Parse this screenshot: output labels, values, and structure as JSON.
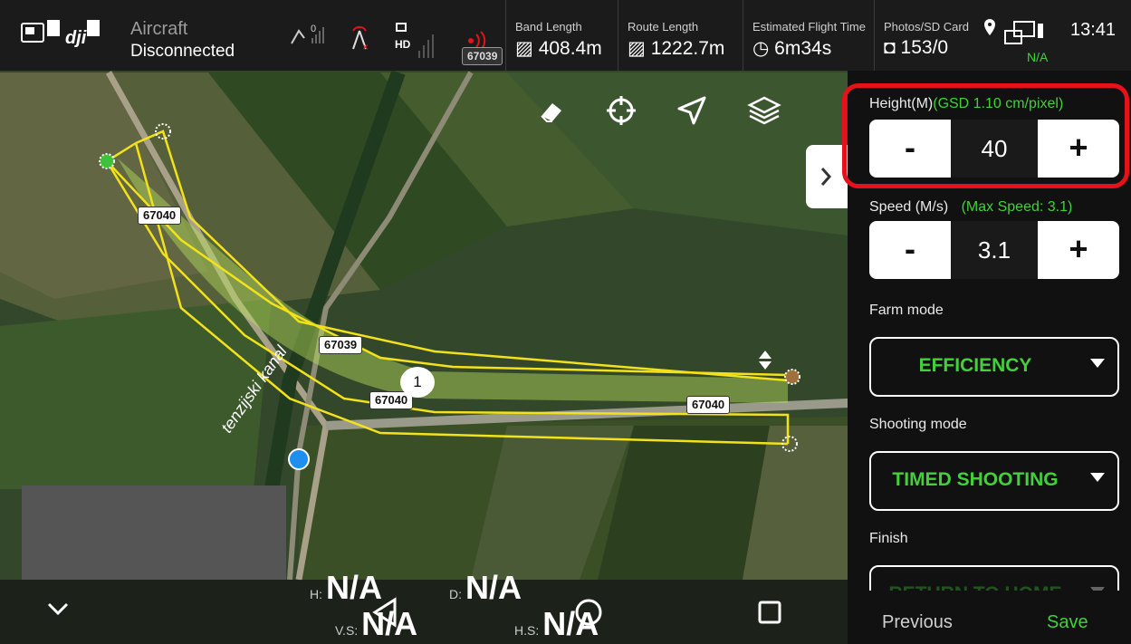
{
  "topbar": {
    "aircraft_title": "Aircraft",
    "aircraft_status": "Disconnected",
    "rc_signal": "0",
    "hd_label": "HD",
    "road_tag": "67039",
    "band_length_label": "Band Length",
    "band_length_value": "408.4m",
    "route_length_label": "Route Length",
    "route_length_value": "1222.7m",
    "flight_time_label": "Estimated Flight Time",
    "flight_time_value": "6m34s",
    "photos_label": "Photos/SD Card",
    "photos_value": "153/0",
    "battery_na": "N/A",
    "clock": "13:41"
  },
  "map": {
    "road_labels": [
      "67040",
      "67039",
      "67040",
      "67040"
    ],
    "side_road_label": "67040",
    "waypoint_number": "1",
    "canal_label": "tenzijski kanal"
  },
  "panel": {
    "height_label": "Height(M)",
    "gsd_label": "(GSD 1.10 cm/pixel)",
    "height_value": "40",
    "minus": "-",
    "plus": "+",
    "speed_label": "Speed (M/s)",
    "max_speed_label": "(Max Speed: 3.1)",
    "speed_value": "3.1",
    "farm_mode_label": "Farm mode",
    "farm_mode_value": "EFFICIENCY",
    "shooting_mode_label": "Shooting mode",
    "shooting_mode_value": "TIMED SHOOTING",
    "finish_label": "Finish",
    "finish_value": "RETURN TO HOME",
    "previous_label": "Previous",
    "save_label": "Save"
  },
  "telemetry": {
    "h_key": "H:",
    "h_val": "N/A",
    "d_key": "D:",
    "d_val": "N/A",
    "vs_key": "V.S:",
    "vs_val": "N/A",
    "hs_key": "H.S:",
    "hs_val": "N/A"
  },
  "colors": {
    "accent": "#43d03a",
    "highlight": "#e3121b",
    "route": "#f2e11b"
  },
  "icons": [
    "dji-logo-icon",
    "sd-card-icon",
    "remote-signal-icon",
    "antenna-icon",
    "hd-icon",
    "gps-signal-icon",
    "eraser-icon",
    "crosshair-icon",
    "navigate-icon",
    "layers-icon",
    "chevron-right-icon",
    "chevron-down-icon",
    "back-icon",
    "home-icon",
    "recents-icon",
    "camera-icon",
    "clock-icon",
    "band-icon",
    "route-icon",
    "location-icon"
  ]
}
